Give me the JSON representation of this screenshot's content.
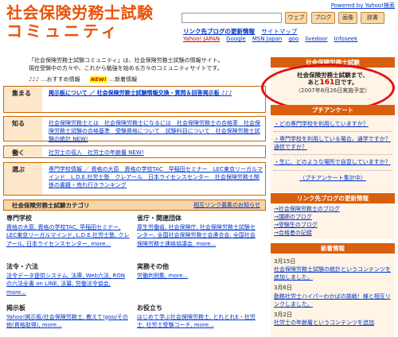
{
  "header": {
    "title_line1": "社会保険労務士試験",
    "title_line2": "コミュニティ",
    "powered_by": "Powered by Yahoo!検索",
    "buttons": {
      "web": "ウェブ",
      "blog": "ブログ",
      "image": "画像",
      "dict": "辞書"
    },
    "link_label": "リンク先ブログの更新情報",
    "sitemap": "サイトマップ",
    "search_links": [
      "Yahoo! JAPAN",
      "Google",
      "MSN Japan",
      "goo",
      "livedoor",
      "Infoseek"
    ]
  },
  "intro": {
    "line1": "「社会保険労務士試験コミュニティ」は、社会保険労務士試験の情報サイト。",
    "line2": "現在受験中の方々や、これから勉強を始める方々のコミュニティサイトです。",
    "recommend": "…おすすめ情報",
    "new_badge": "NEW!",
    "news_label": "…新着情報",
    "arrows": "♪♪♪"
  },
  "boxes": [
    {
      "label": "集まる",
      "text": "掲示板について ／ 社会保険労務士試験情報交換・質問＆回答掲示板 ♪♪♪"
    },
    {
      "label": "知る",
      "text": "社会保険労務士とは　社会保険労務士になるには　社会保険労務士の合格率　社会保険労務士試験の合格基準　受験資格について　試験科目について　社会保険労務士試験の統計 NEW!"
    },
    {
      "label": "働く",
      "text": "社労士の収入　社労士の年齢層 NEW!"
    },
    {
      "label": "選ぶ",
      "text": "専門学校情報 ／ 資格の大原　資格の学校TAC　早稲田セミナー　LEC東京リーガルマインド　L.D.E.社労士塾　クレアール　日本ライセンスセンター　社会保険労務士関係の書籍・売れ行きランキング"
    }
  ],
  "category": {
    "title": "社会保険労務士試験カテゴリ",
    "link": "相互リンク募集のお知らせ",
    "items": [
      {
        "head": "専門学校",
        "body": "資格の大原, 資格の学校TAC, 早稲田セミナー, LEC東京リーガルマインド, L.D.E.社労士塾, クレアール, 日本ライセンスセンター, more..."
      },
      {
        "head": "省庁・関連団体",
        "body": "厚生労働省, 社会保険庁, 社会保険労務士試験センター, 全国社会保険労務士会連合会, 全国社会保険労務士連絡協議会, more..."
      },
      {
        "head": "法令・六法",
        "body": "法令データ提供システム, 法庫, Web六法, RONの六法全書 on LINE, 法纂, 労働法令協会, more..."
      },
      {
        "head": "実務その他",
        "body": "労働判例集, more..."
      },
      {
        "head": "掲示板",
        "body": "Yahoo!掲示板/社会保険労務士, 教えて!goo/その他(資格取得), more..."
      },
      {
        "head": "お役立ち",
        "body": "はじめて学ぶ社会保険労務士, とれとれE・社労士, 社労士受験コーチ, more..."
      }
    ]
  },
  "countdown": {
    "title": "社会保険労務士試験",
    "line1": "社会保険労務士試験まで、",
    "prefix": "あと",
    "days": "161",
    "suffix": "日です。",
    "note": "（2007年8月26日実施予定）"
  },
  "survey": {
    "title": "プチアンケート",
    "questions": [
      "・どの専門学校を利用していますか？",
      "・専門学校を利用している場合、通学ですか？通信ですか？",
      "・生に、どのような場所で自習していますか？"
    ],
    "link": "（プチアンケート集計中）"
  },
  "blog_updates": {
    "title": "リンク先ブログの更新情報",
    "items": [
      "→社会保険労務士のブログ",
      "→講師のブログ",
      "→受験生のブログ",
      "→合格者の記録"
    ]
  },
  "news": {
    "title": "新着情報",
    "items": [
      {
        "date": "3月15日",
        "text": "社会保険労務士試験の統計というコンテンツを追加しました。"
      },
      {
        "date": "3月6日",
        "text": "勤務社労士ハイパーわかばの挑戦！様と相互リンクしました。"
      },
      {
        "date": "3月2日",
        "text": "社労士の年齢層というコンテンツを追加"
      }
    ]
  },
  "colors": {
    "accent": "#e8540b",
    "side_header": "#d95f0e",
    "highlight": "#e01010"
  }
}
